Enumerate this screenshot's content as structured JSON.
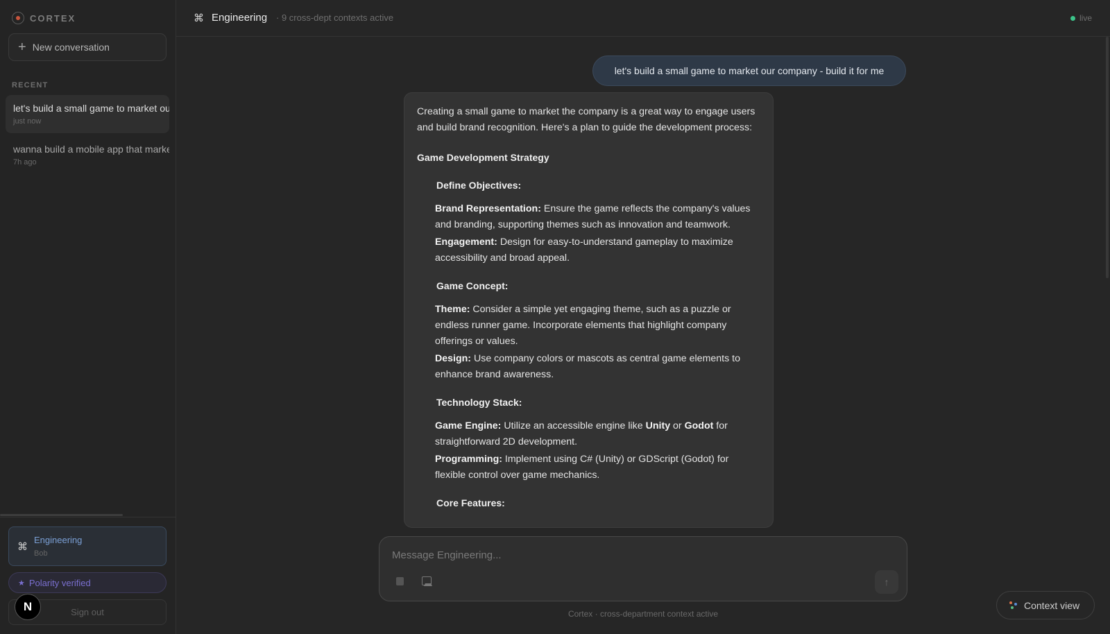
{
  "sidebar": {
    "brand": "CORTEX",
    "new_conversation": "New conversation",
    "recent_label": "RECENT",
    "conversations": [
      {
        "title": "let's build a small game to market our company - build it for me",
        "time": "just now"
      },
      {
        "title": "wanna build a mobile app that markets our company",
        "time": "7h ago"
      }
    ],
    "workspace": {
      "name": "Engineering",
      "user": "Bob"
    },
    "polarity": "Polarity verified",
    "sign_out": "Sign out",
    "avatar_letter": "N"
  },
  "header": {
    "title": "Engineering",
    "subtitle": "· 9 cross-dept contexts active",
    "status": "live"
  },
  "chat": {
    "user_message": "let's build a small game to market our company - build it for me",
    "assistant": {
      "intro": "Creating a small game to market the company is a great way to engage users and build brand recognition. Here's a plan to guide the development process:",
      "heading": "Game Development Strategy",
      "sections": [
        {
          "title": "Define Objectives:",
          "items": [
            {
              "label": "Brand Representation:",
              "text": " Ensure the game reflects the company's values and branding, supporting themes such as innovation and teamwork."
            },
            {
              "label": "Engagement:",
              "text": " Design for easy-to-understand gameplay to maximize accessibility and broad appeal."
            }
          ]
        },
        {
          "title": "Game Concept:",
          "items": [
            {
              "label": "Theme:",
              "text": " Consider a simple yet engaging theme, such as a puzzle or endless runner game. Incorporate elements that highlight company offerings or values."
            },
            {
              "label": "Design:",
              "text": " Use company colors or mascots as central game elements to enhance brand awareness."
            }
          ]
        },
        {
          "title": "Technology Stack:",
          "items": [
            {
              "label": "Game Engine:",
              "text_parts": [
                " Utilize an accessible engine like ",
                "Unity",
                " or ",
                "Godot",
                " for straightforward 2D development."
              ]
            },
            {
              "label": "Programming:",
              "text": " Implement using C# (Unity) or GDScript (Godot) for flexible control over game mechanics."
            }
          ]
        },
        {
          "title": "Core Features:",
          "items": []
        }
      ]
    }
  },
  "composer": {
    "placeholder": "Message Engineering...",
    "footer": "Cortex · cross-department context active"
  },
  "context_button": "Context view",
  "colors": {
    "accent_blue": "#7ba0d6",
    "polarity_purple": "#7a6fd0",
    "live_green": "#3cc48a"
  }
}
